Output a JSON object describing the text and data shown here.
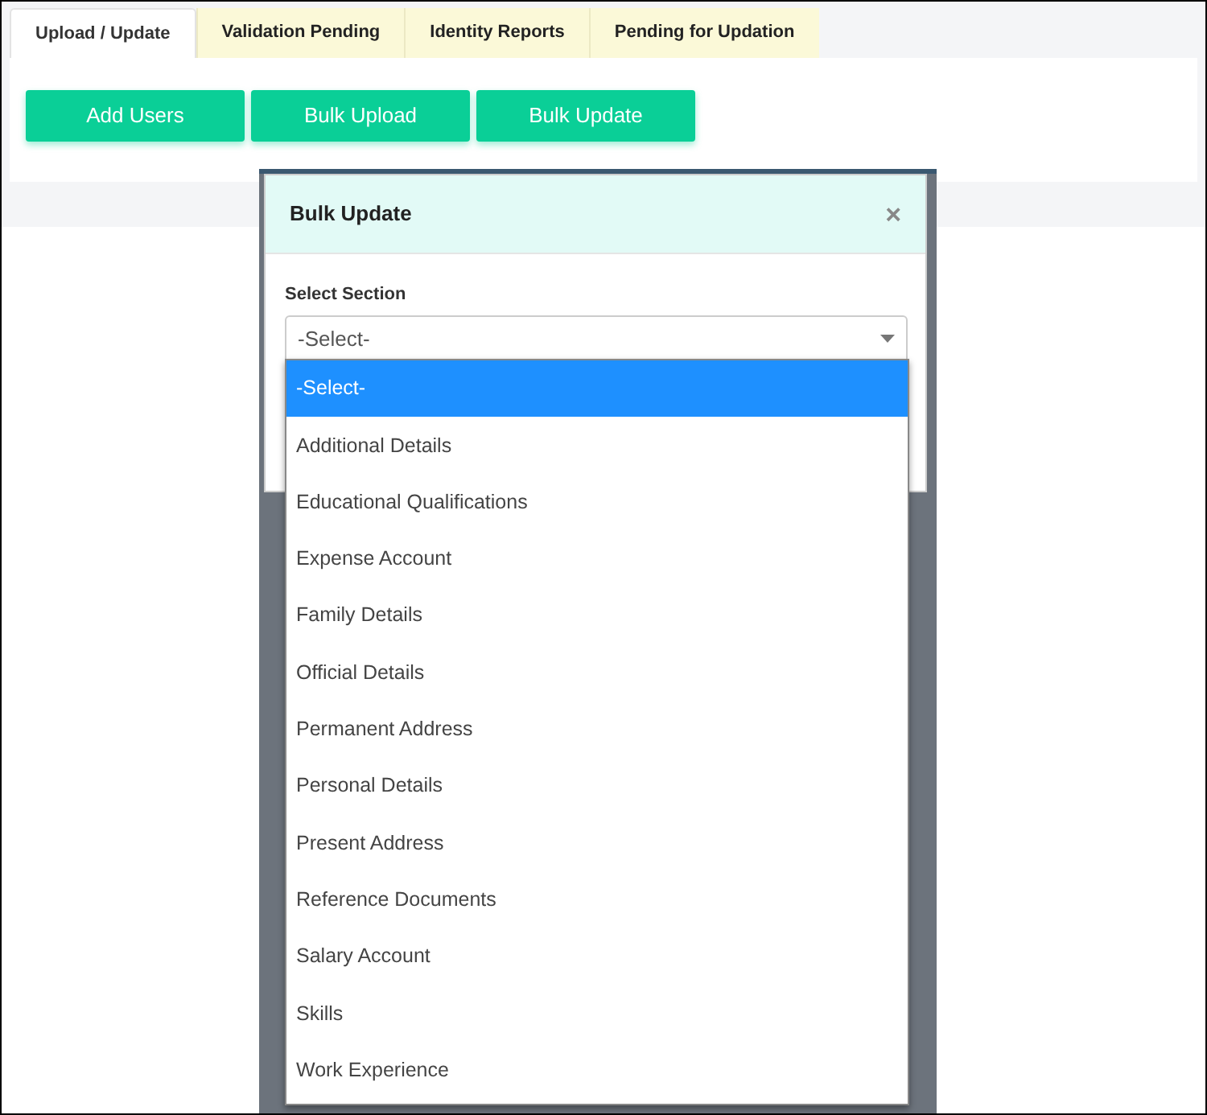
{
  "tabs": [
    {
      "label": "Upload / Update",
      "selected": true
    },
    {
      "label": "Validation Pending",
      "selected": false
    },
    {
      "label": "Identity Reports",
      "selected": false
    },
    {
      "label": "Pending for Updation",
      "selected": false
    }
  ],
  "buttons": [
    "Add Users",
    "Bulk Upload",
    "Bulk Update"
  ],
  "modal": {
    "title": "Bulk Update",
    "close": "×",
    "field_label": "Select Section",
    "value": "-Select-",
    "options": [
      {
        "label": "-Select-",
        "selected": true
      },
      {
        "label": "Additional Details",
        "selected": false
      },
      {
        "label": "Educational Qualifications",
        "selected": false
      },
      {
        "label": "Expense Account",
        "selected": false
      },
      {
        "label": "Family Details",
        "selected": false
      },
      {
        "label": "Official Details",
        "selected": false
      },
      {
        "label": "Permanent Address",
        "selected": false
      },
      {
        "label": "Personal Details",
        "selected": false
      },
      {
        "label": "Present Address",
        "selected": false
      },
      {
        "label": "Reference Documents",
        "selected": false
      },
      {
        "label": "Salary Account",
        "selected": false
      },
      {
        "label": "Skills",
        "selected": false
      },
      {
        "label": "Work Experience",
        "selected": false
      }
    ]
  }
}
